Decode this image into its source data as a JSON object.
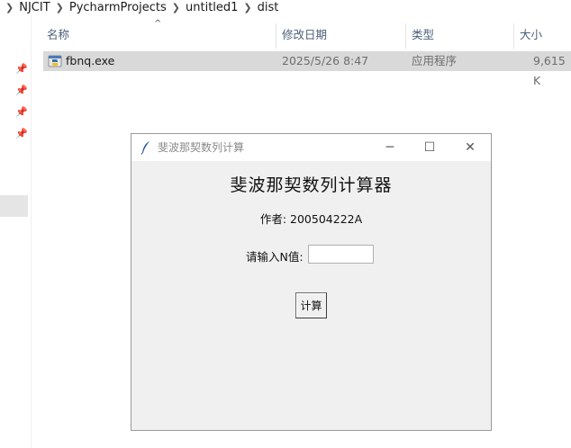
{
  "explorer": {
    "breadcrumb": [
      "NJCIT",
      "PycharmProjects",
      "untitled1",
      "dist"
    ],
    "columns": {
      "name": "名称",
      "date": "修改日期",
      "type": "类型",
      "size": "大小"
    },
    "files": [
      {
        "name": "fbnq.exe",
        "date": "2025/5/26 8:47",
        "type": "应用程序",
        "size": "9,615 K"
      }
    ]
  },
  "app_window": {
    "title": "斐波那契数列计算",
    "heading": "斐波那契数列计算器",
    "author": "作者: 200504222A",
    "input_label": "请输入N值:",
    "input_value": "",
    "calc_button": "计算"
  }
}
